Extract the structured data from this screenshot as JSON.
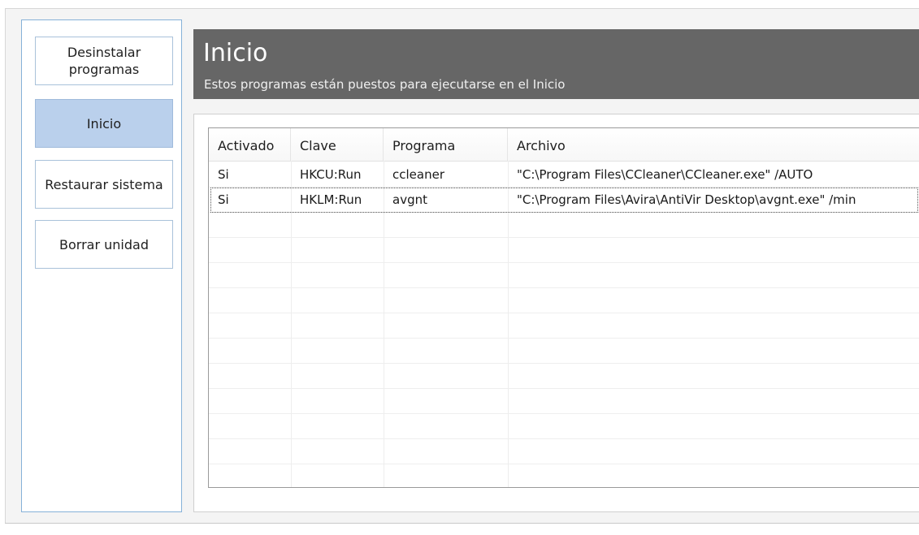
{
  "sidebar": {
    "items": [
      {
        "label": "Desinstalar\nprogramas",
        "active": false
      },
      {
        "label": "Inicio",
        "active": true
      },
      {
        "label": "Restaurar sistema",
        "active": false
      },
      {
        "label": "Borrar unidad",
        "active": false
      }
    ]
  },
  "header": {
    "title": "Inicio",
    "subtitle": "Estos programas están puestos para ejecutarse en el Inicio"
  },
  "table": {
    "columns": [
      "Activado",
      "Clave",
      "Programa",
      "Archivo"
    ],
    "rows": [
      [
        "Si",
        "HKCU:Run",
        "ccleaner",
        "\"C:\\Program Files\\CCleaner\\CCleaner.exe\" /AUTO"
      ],
      [
        "Si",
        "HKLM:Run",
        "avgnt",
        "\"C:\\Program Files\\Avira\\AntiVir Desktop\\avgnt.exe\" /min"
      ]
    ]
  },
  "colors": {
    "header_bg": "#666666",
    "active_item_bg": "#bad0ec",
    "sidebar_border": "#86b1d8"
  }
}
